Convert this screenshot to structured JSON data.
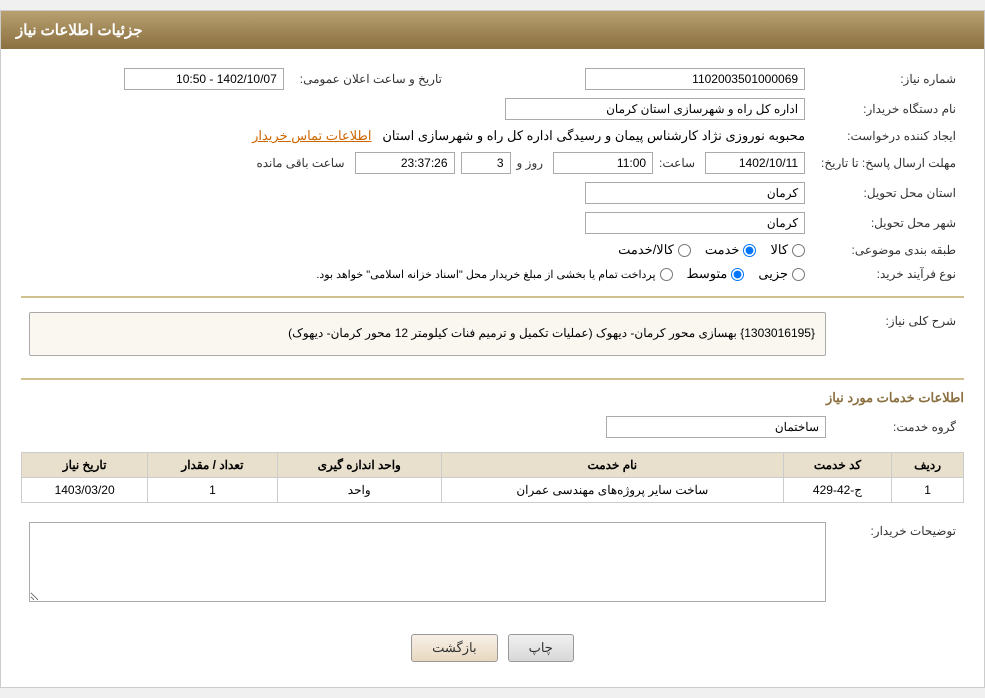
{
  "page": {
    "title": "جزئیات اطلاعات نیاز",
    "header": "جزئیات اطلاعات نیاز"
  },
  "fields": {
    "need_number_label": "شماره نیاز:",
    "need_number_value": "1102003501000069",
    "buyer_org_label": "نام دستگاه خریدار:",
    "buyer_org_value": "اداره کل راه و شهرسازی استان کرمان",
    "announce_date_label": "تاریخ و ساعت اعلان عمومی:",
    "announce_date_value": "1402/10/07 - 10:50",
    "creator_label": "ایجاد کننده درخواست:",
    "creator_value": "محبوبه نوروزی نژاد کارشناس پیمان و رسیدگی اداره کل راه و شهرسازی استان",
    "creator_contact": "اطلاعات تماس خریدار",
    "send_deadline_label": "مهلت ارسال پاسخ: تا تاریخ:",
    "send_date": "1402/10/11",
    "send_time_label": "ساعت:",
    "send_time": "11:00",
    "send_days_label": "روز و",
    "send_days": "3",
    "send_remaining_label": "ساعت باقی مانده",
    "send_remaining": "23:37:26",
    "province_label": "استان محل تحویل:",
    "province_value": "کرمان",
    "city_label": "شهر محل تحویل:",
    "city_value": "کرمان",
    "category_label": "طبقه بندی موضوعی:",
    "category_options": [
      "کالا",
      "خدمت",
      "کالا/خدمت"
    ],
    "category_selected": "خدمت",
    "purchase_type_label": "نوع فرآیند خرید:",
    "purchase_options": [
      "جزیی",
      "متوسط",
      "پرداخت تمام یا بخشی از مبلغ خریدار محل \"اسناد خزانه اسلامی\" خواهد بود."
    ],
    "purchase_selected": "متوسط",
    "need_description_label": "شرح کلی نیاز:",
    "need_description": "{1303016195} بهسازی محور کرمان- دیهوک (عملیات تکمیل و ترمیم فنات کیلومتر 12 محور کرمان- دیهوک)",
    "services_section": "اطلاعات خدمات مورد نیاز",
    "service_group_label": "گروه خدمت:",
    "service_group_value": "ساختمان",
    "table": {
      "headers": [
        "ردیف",
        "کد خدمت",
        "نام خدمت",
        "واحد اندازه گیری",
        "تعداد / مقدار",
        "تاریخ نیاز"
      ],
      "rows": [
        {
          "row": "1",
          "code": "ج-42-429",
          "name": "ساخت سایر پروژه‌های مهندسی عمران",
          "unit_measure": "واحد",
          "quantity": "1",
          "date_needed": "1403/03/20"
        }
      ]
    },
    "buyer_notes_label": "توضیحات خریدار:",
    "buyer_notes_value": ""
  },
  "buttons": {
    "print": "چاپ",
    "back": "بازگشت"
  }
}
